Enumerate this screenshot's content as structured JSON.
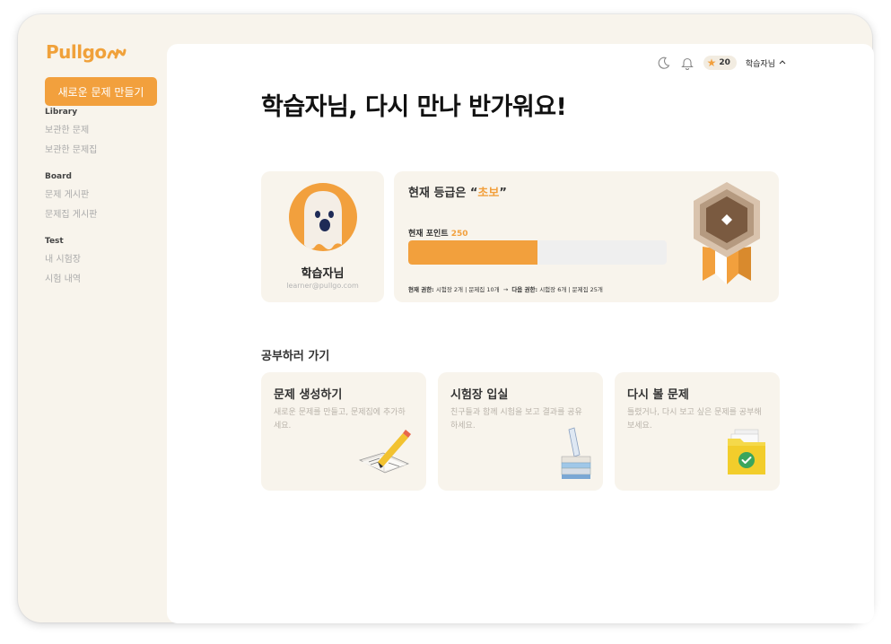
{
  "brand": {
    "logo_text": "Pullgo",
    "accent_color": "#f2a03d"
  },
  "sidebar": {
    "new_button_label": "새로운 문제 만들기",
    "sections": [
      {
        "heading": "Library",
        "items": [
          "보관한 문제",
          "보관한 문제집"
        ]
      },
      {
        "heading": "Board",
        "items": [
          "문제 게시판",
          "문제집 게시판"
        ]
      },
      {
        "heading": "Test",
        "items": [
          "내 시험장",
          "시험 내역"
        ]
      }
    ]
  },
  "topbar": {
    "icons": [
      "moon-icon",
      "bell-icon"
    ],
    "points": "20",
    "username": "학습자님",
    "chevron": "^"
  },
  "greeting": "학습자님, 다시 만나 반가워요!",
  "profile": {
    "name": "학습자님",
    "email": "learner@pullgo.com",
    "avatar": "ghost-avatar"
  },
  "grade": {
    "title_prefix": "현재 등급은 “",
    "grade_name": "초보",
    "title_suffix": "”",
    "points_label": "현재 포인트",
    "points_value": "250",
    "progress_fraction": 0.5,
    "current_perm_label": "현재 권한:",
    "current_perm_value": "시험장 2개 | 문제집 10개",
    "arrow": "→",
    "next_perm_label": "다음 권한:",
    "next_perm_value": "시험장 6개 | 문제집 25개"
  },
  "study": {
    "section_title": "공부하러 가기",
    "cards": [
      {
        "title": "문제 생성하기",
        "desc": "새로운 문제를 만들고, 문제집에 추가하세요.",
        "icon": "book-pencil-icon"
      },
      {
        "title": "시험장 입실",
        "desc": "친구들과 함께 시험을 보고 결과를 공유하세요.",
        "icon": "books-test-tube-icon"
      },
      {
        "title": "다시 볼 문제",
        "desc": "틀렸거나, 다시 보고 싶은 문제를 공부해보세요.",
        "icon": "folder-check-icon"
      }
    ]
  }
}
